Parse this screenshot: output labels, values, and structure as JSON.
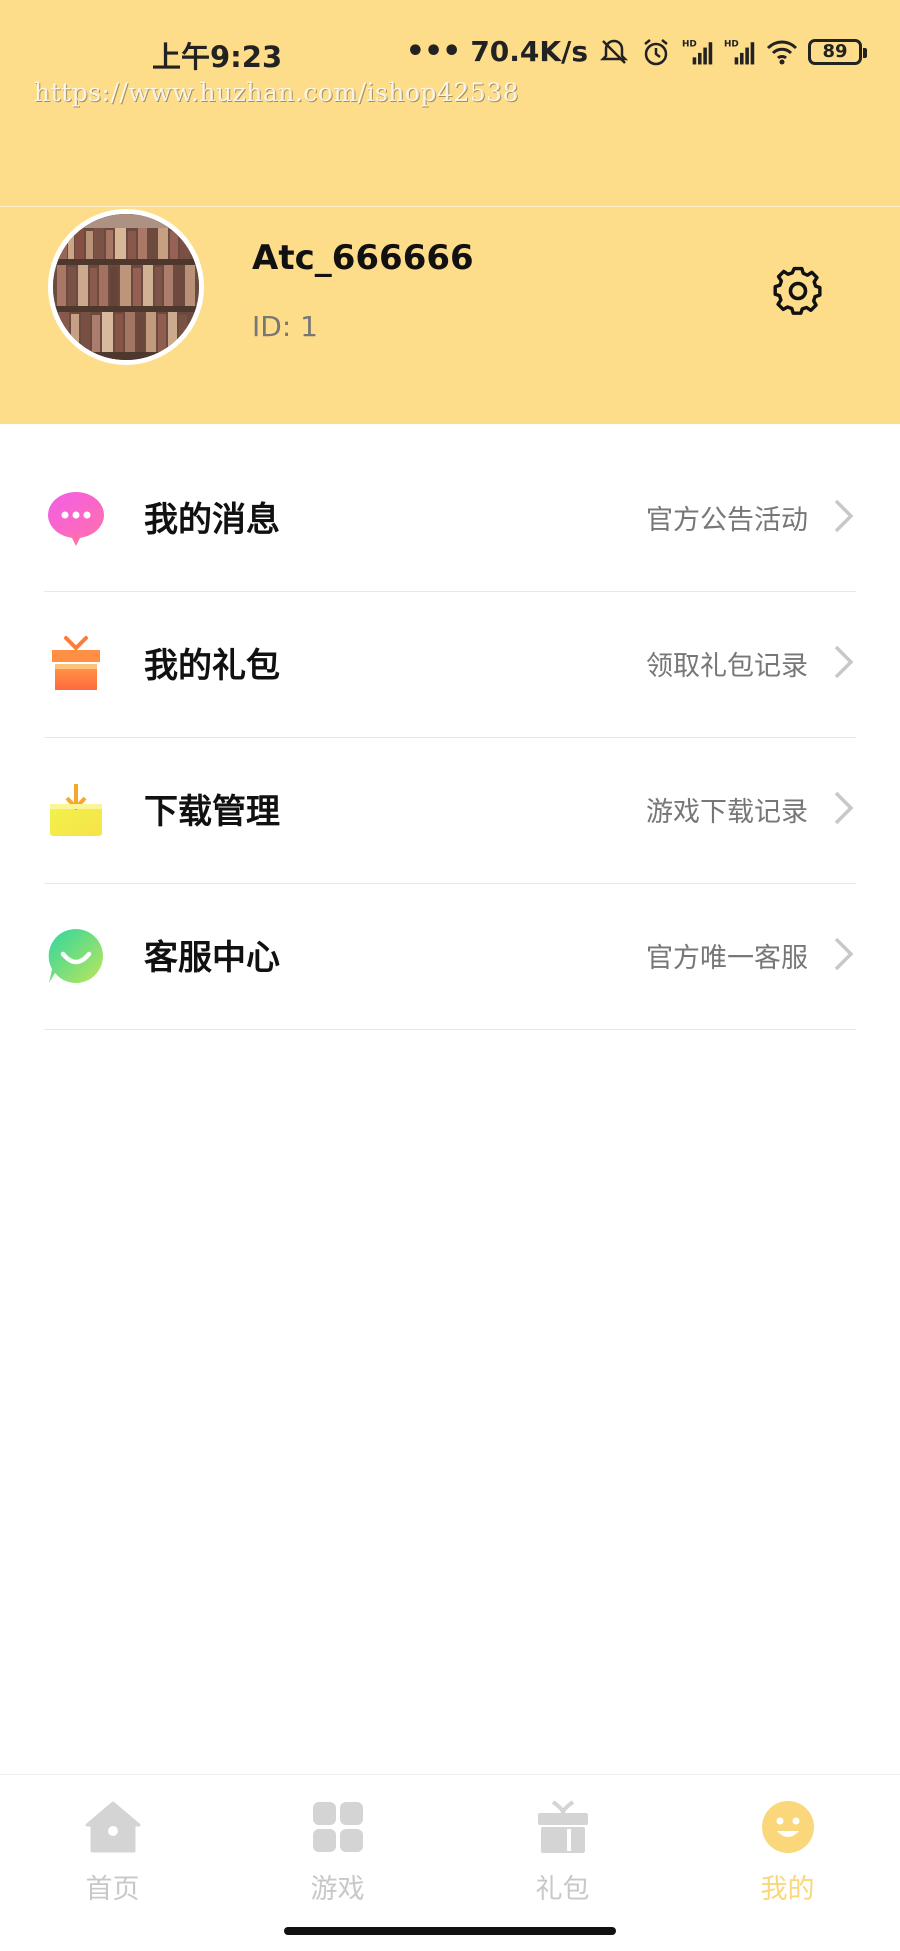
{
  "status_bar": {
    "time": "上午9:23",
    "network_speed": "70.4K/s",
    "battery": "89",
    "icons": [
      "mute-icon",
      "alarm-icon",
      "hd-signal-icon",
      "hd-signal-icon",
      "wifi-icon",
      "battery-icon"
    ]
  },
  "watermark": "https://www.huzhan.com/ishop42538",
  "profile": {
    "username": "Atc_666666",
    "id": "ID: 1",
    "avatar_icon": "bookshelf-avatar",
    "settings_icon": "gear-icon"
  },
  "menu": [
    {
      "title": "我的消息",
      "subtitle": "官方公告活动",
      "icon": "message-bubble-icon"
    },
    {
      "title": "我的礼包",
      "subtitle": "领取礼包记录",
      "icon": "gift-box-icon"
    },
    {
      "title": "下载管理",
      "subtitle": "游戏下载记录",
      "icon": "download-tray-icon"
    },
    {
      "title": "客服中心",
      "subtitle": "官方唯一客服",
      "icon": "smile-chat-icon"
    }
  ],
  "bottom_nav": [
    {
      "label": "首页",
      "icon": "home-icon",
      "active": false
    },
    {
      "label": "游戏",
      "icon": "grid-icon",
      "active": false
    },
    {
      "label": "礼包",
      "icon": "gift-icon",
      "active": false
    },
    {
      "label": "我的",
      "icon": "smile-icon",
      "active": true
    }
  ],
  "colors": {
    "header_bg": "#FEDD8A",
    "active_tab": "#F9D77A",
    "inactive_tab": "#C8C8C8",
    "subtitle_text": "#777777"
  }
}
